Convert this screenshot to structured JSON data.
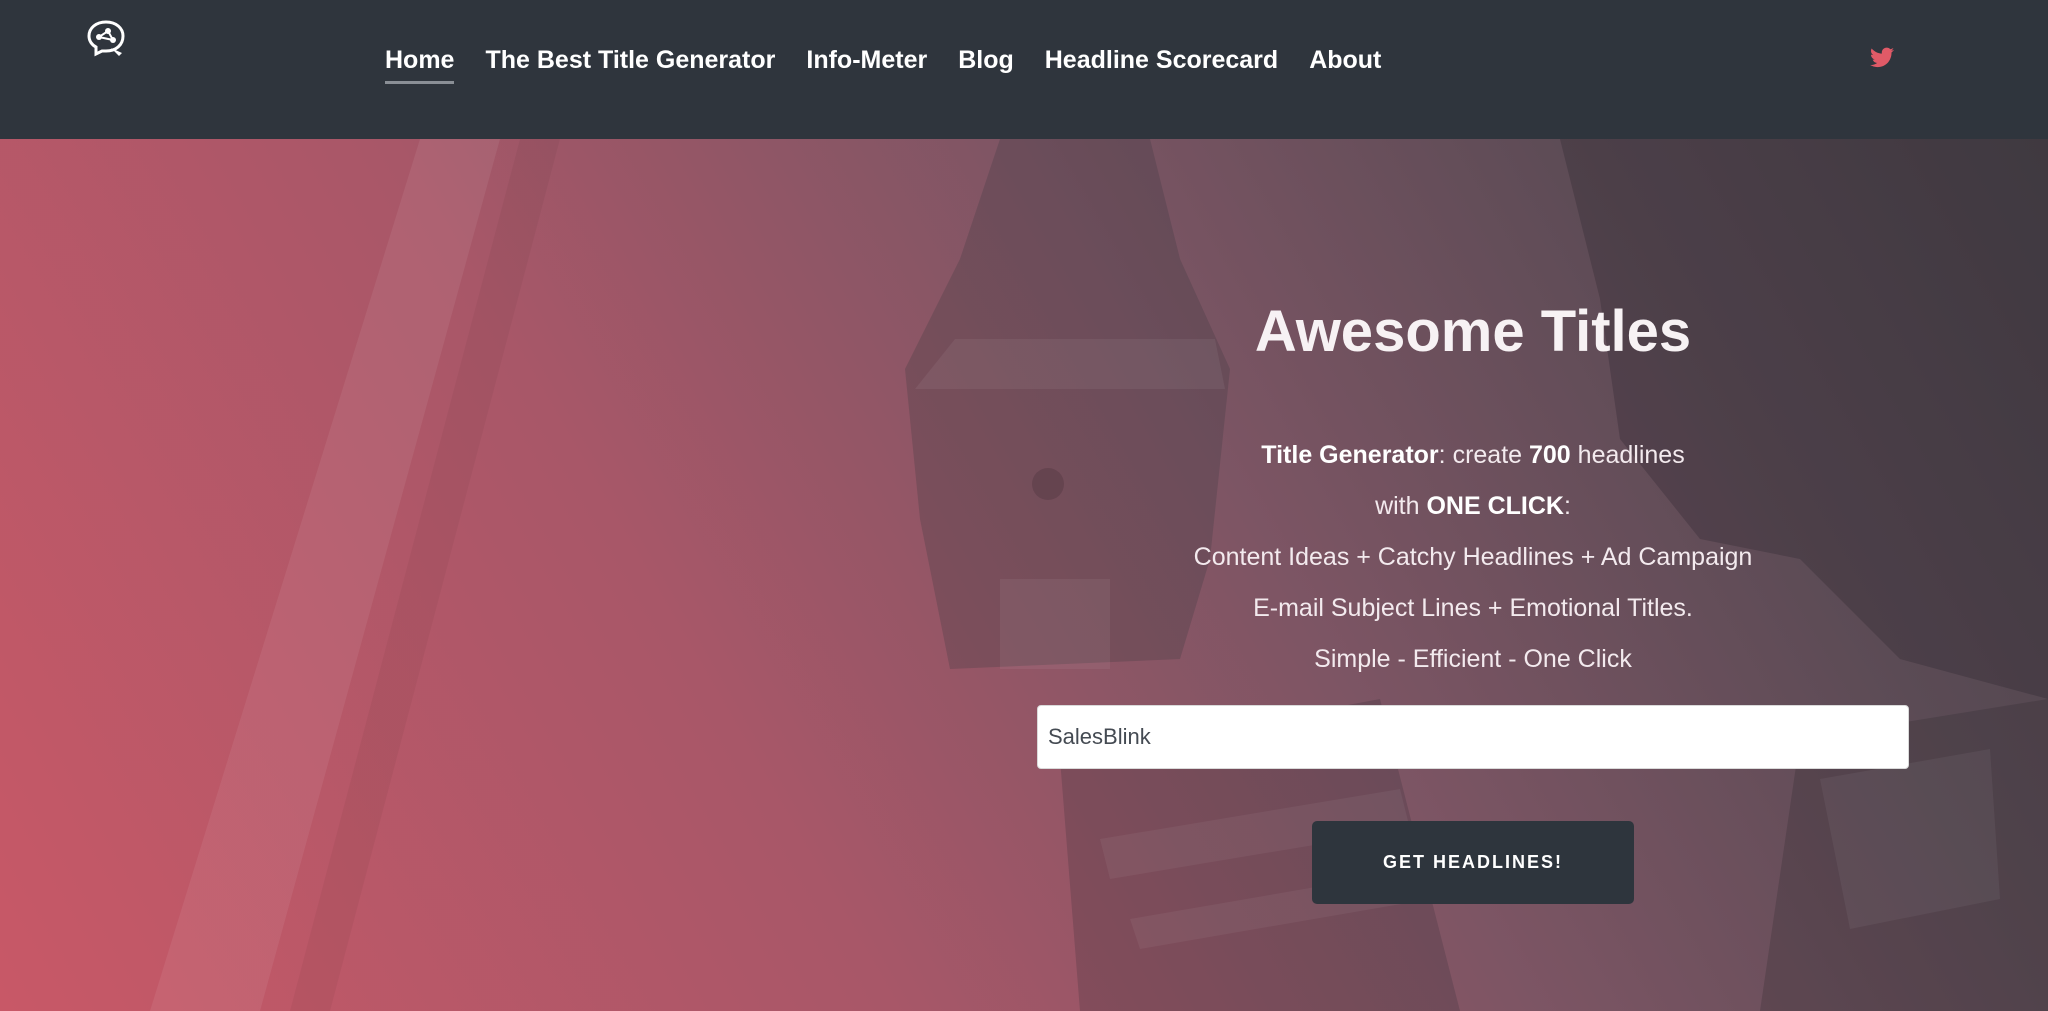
{
  "nav": {
    "items": [
      {
        "label": "Home",
        "active": true
      },
      {
        "label": "The Best Title Generator"
      },
      {
        "label": "Info-Meter"
      },
      {
        "label": "Blog"
      },
      {
        "label": "Headline Scorecard"
      },
      {
        "label": "About"
      }
    ],
    "logo_icon": "brain-icon",
    "social_icon": "twitter-icon"
  },
  "hero": {
    "title": "Awesome Titles",
    "line1": {
      "bold1": "Title Generator",
      "text1": ": create ",
      "bold2": "700",
      "text2": " headlines"
    },
    "line2": {
      "text1": "with ",
      "bold1": "ONE CLICK",
      "text2": ":"
    },
    "line3": "Content Ideas + Catchy Headlines + Ad Campaign",
    "line4": "E-mail Subject Lines + Emotional Titles.",
    "line5": "Simple - Efficient - One Click",
    "input_value": "SalesBlink",
    "button_label": "GET HEADLINES!"
  },
  "colors": {
    "navbar_bg": "#2f353d",
    "twitter": "#e05a67",
    "button_bg": "#2e353d",
    "hero_gradient_start": "#c85867",
    "hero_gradient_end": "#4a434a"
  }
}
